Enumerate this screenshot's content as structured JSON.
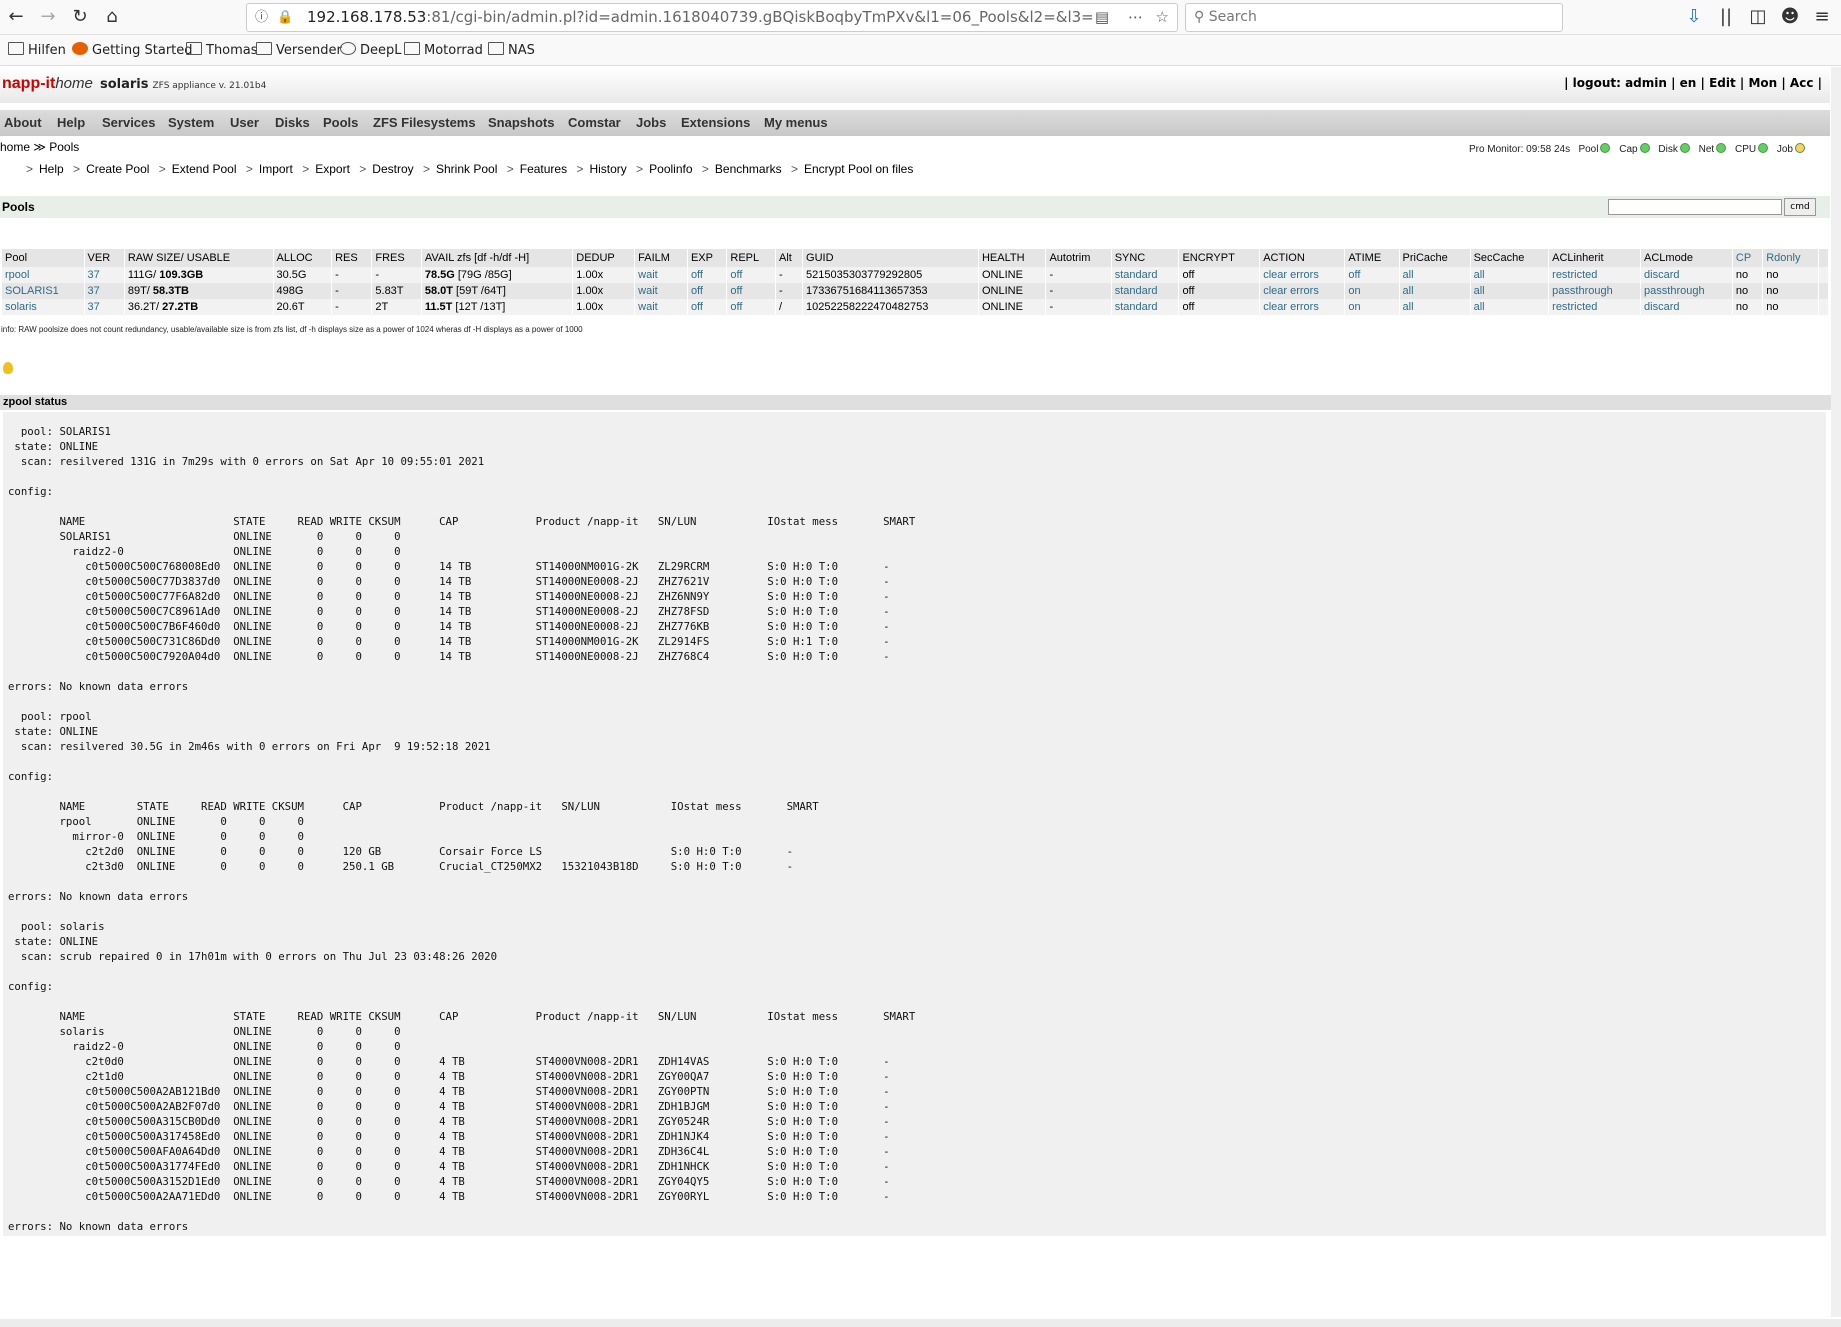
{
  "browser": {
    "url_host": "192.168.178.53",
    "url_rest": ":81/cgi-bin/admin.pl?id=admin.1618040739.gBQiskBoqbyTmPXv&l1=06_Pools&l2=&l3=",
    "search_placeholder": "Search",
    "bookmarks": [
      "Hilfen",
      "Getting Started",
      "Thomas",
      "Versender",
      "DeepL",
      "Motorrad",
      "NAS"
    ]
  },
  "header": {
    "logo": "napp-it",
    "logo_home": "home",
    "host": "solaris",
    "version": "ZFS appliance v. 21.01b4",
    "topright": "| logout: admin | en | Edit | Mon | Acc |"
  },
  "menu": [
    "About",
    "Help",
    "Services",
    "System",
    "User",
    "Disks",
    "Pools",
    "ZFS Filesystems",
    "Snapshots",
    "Comstar",
    "Jobs",
    "Extensions",
    "My menus"
  ],
  "breadcrumb": "home ≫ Pools",
  "monitor": {
    "label": "Pro Monitor: 09:58 24s",
    "items": [
      "Pool",
      "Cap",
      "Disk",
      "Net",
      "CPU",
      "Job"
    ]
  },
  "submenu": [
    "Help",
    "Create Pool",
    "Extend Pool",
    "Import",
    "Export",
    "Destroy",
    "Shrink Pool",
    "Features",
    "History",
    "Poolinfo",
    "Benchmarks",
    "Encrypt Pool on files"
  ],
  "pools_title": "Pools",
  "cmd_label": "cmd",
  "table": {
    "headers": [
      "Pool",
      "VER",
      "RAW SIZE/ USABLE",
      "ALLOC",
      "RES",
      "FRES",
      "AVAIL zfs [df -h/df -H]",
      "DEDUP",
      "FAILM",
      "EXP",
      "REPL",
      "Alt",
      "GUID",
      "HEALTH",
      "Autotrim",
      "SYNC",
      "ENCRYPT",
      "ACTION",
      "ATIME",
      "PriCache",
      "SecCache",
      "ACLinherit",
      "ACLmode",
      "CP",
      "Rdonly",
      ""
    ],
    "rows": [
      [
        "rpool",
        "37",
        "111G/ 109.3GB",
        "30.5G",
        "-",
        "-",
        "78.5G [79G /85G]",
        "1.00x",
        "wait",
        "off",
        "off",
        "-",
        "5215035303779292805",
        "ONLINE",
        "-",
        "standard",
        "off",
        "clear errors",
        "off",
        "all",
        "all",
        "restricted",
        "discard",
        "no",
        "no",
        ""
      ],
      [
        "SOLARIS1",
        "37",
        "89T/ 58.3TB",
        "498G",
        "-",
        "5.83T",
        "58.0T [59T /64T]",
        "1.00x",
        "wait",
        "off",
        "off",
        "-",
        "17336751684113657353",
        "ONLINE",
        "-",
        "standard",
        "off",
        "clear errors",
        "on",
        "all",
        "all",
        "passthrough",
        "passthrough",
        "no",
        "no",
        ""
      ],
      [
        "solaris",
        "37",
        "36.2T/ 27.2TB",
        "20.6T",
        "-",
        "2T",
        "11.5T [12T /13T]",
        "1.00x",
        "wait",
        "off",
        "off",
        "/",
        "10252258222470482753",
        "ONLINE",
        "-",
        "standard",
        "off",
        "clear errors",
        "on",
        "all",
        "all",
        "restricted",
        "discard",
        "no",
        "no",
        ""
      ]
    ]
  },
  "info": "info: RAW poolsize does not count redundancy, usable/available size is from zfs list, df -h displays size as a power of 1024 wheras df -H displays as a power of 1000",
  "zpool_title": "zpool status",
  "zpool_status": "  pool: SOLARIS1\n state: ONLINE\n  scan: resilvered 131G in 7m29s with 0 errors on Sat Apr 10 09:55:01 2021\n\nconfig:\n\n        NAME                       STATE     READ WRITE CKSUM      CAP            Product /napp-it   SN/LUN           IOstat mess       SMART\n        SOLARIS1                   ONLINE       0     0     0\n          raidz2-0                 ONLINE       0     0     0\n            c0t5000C500C768008Ed0  ONLINE       0     0     0      14 TB          ST14000NM001G-2K   ZL29RCRM         S:0 H:0 T:0       -\n            c0t5000C500C77D3837d0  ONLINE       0     0     0      14 TB          ST14000NE0008-2J   ZHZ7621V         S:0 H:0 T:0       -\n            c0t5000C500C77F6A82d0  ONLINE       0     0     0      14 TB          ST14000NE0008-2J   ZHZ6NN9Y         S:0 H:0 T:0       -\n            c0t5000C500C7C8961Ad0  ONLINE       0     0     0      14 TB          ST14000NE0008-2J   ZHZ78FSD         S:0 H:0 T:0       -\n            c0t5000C500C7B6F460d0  ONLINE       0     0     0      14 TB          ST14000NE0008-2J   ZHZ776KB         S:0 H:0 T:0       -\n            c0t5000C500C731C86Dd0  ONLINE       0     0     0      14 TB          ST14000NM001G-2K   ZL2914FS         S:0 H:1 T:0       -\n            c0t5000C500C7920A04d0  ONLINE       0     0     0      14 TB          ST14000NE0008-2J   ZHZ768C4         S:0 H:0 T:0       -\n\nerrors: No known data errors\n\n  pool: rpool\n state: ONLINE\n  scan: resilvered 30.5G in 2m46s with 0 errors on Fri Apr  9 19:52:18 2021\n\nconfig:\n\n        NAME        STATE     READ WRITE CKSUM      CAP            Product /napp-it   SN/LUN           IOstat mess       SMART\n        rpool       ONLINE       0     0     0\n          mirror-0  ONLINE       0     0     0\n            c2t2d0  ONLINE       0     0     0      120 GB         Corsair Force LS                    S:0 H:0 T:0       -\n            c2t3d0  ONLINE       0     0     0      250.1 GB       Crucial_CT250MX2   15321043B18D     S:0 H:0 T:0       -\n\nerrors: No known data errors\n\n  pool: solaris\n state: ONLINE\n  scan: scrub repaired 0 in 17h01m with 0 errors on Thu Jul 23 03:48:26 2020\n\nconfig:\n\n        NAME                       STATE     READ WRITE CKSUM      CAP            Product /napp-it   SN/LUN           IOstat mess       SMART\n        solaris                    ONLINE       0     0     0\n          raidz2-0                 ONLINE       0     0     0\n            c2t0d0                 ONLINE       0     0     0      4 TB           ST4000VN008-2DR1   ZDH14VAS         S:0 H:0 T:0       -\n            c2t1d0                 ONLINE       0     0     0      4 TB           ST4000VN008-2DR1   ZGY00QA7         S:0 H:0 T:0       -\n            c0t5000C500A2AB121Bd0  ONLINE       0     0     0      4 TB           ST4000VN008-2DR1   ZGY00PTN         S:0 H:0 T:0       -\n            c0t5000C500A2AB2F07d0  ONLINE       0     0     0      4 TB           ST4000VN008-2DR1   ZDH1BJGM         S:0 H:0 T:0       -\n            c0t5000C500A315CB0Dd0  ONLINE       0     0     0      4 TB           ST4000VN008-2DR1   ZGY0524R         S:0 H:0 T:0       -\n            c0t5000C500A317458Ed0  ONLINE       0     0     0      4 TB           ST4000VN008-2DR1   ZDH1NJK4         S:0 H:0 T:0       -\n            c0t5000C500AFA0A64Dd0  ONLINE       0     0     0      4 TB           ST4000VN008-2DR1   ZDH36C4L         S:0 H:0 T:0       -\n            c0t5000C500A31774FEd0  ONLINE       0     0     0      4 TB           ST4000VN008-2DR1   ZDH1NHCK         S:0 H:0 T:0       -\n            c0t5000C500A3152D1Ed0  ONLINE       0     0     0      4 TB           ST4000VN008-2DR1   ZGY04QY5         S:0 H:0 T:0       -\n            c0t5000C500A2AA71EDd0  ONLINE       0     0     0      4 TB           ST4000VN008-2DR1   ZGY00RYL         S:0 H:0 T:0       -\n\nerrors: No known data errors"
}
